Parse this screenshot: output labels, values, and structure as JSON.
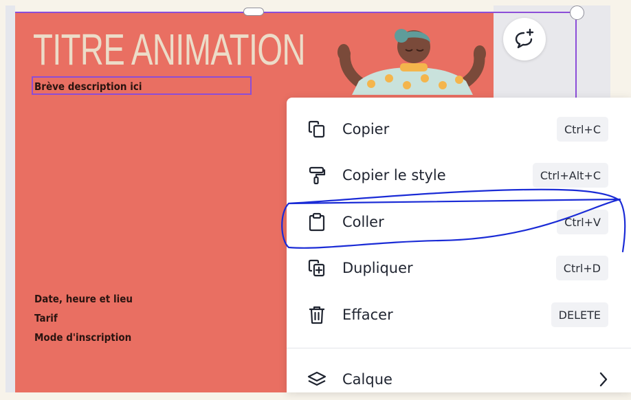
{
  "design": {
    "title": "TITRE ANIMATION",
    "subtitle": "Brève description ici",
    "info_lines": [
      "Date, heure et lieu",
      "Tarif",
      "Mode d'inscription"
    ],
    "background_color": "#e96f62",
    "selection_color": "#8b4dd8"
  },
  "comment_button": {
    "icon": "add-comment-icon"
  },
  "context_menu": {
    "items": [
      {
        "label": "Copier",
        "shortcut": "Ctrl+C",
        "icon": "copy-icon"
      },
      {
        "label": "Copier le style",
        "shortcut": "Ctrl+Alt+C",
        "icon": "paint-roller-icon"
      },
      {
        "label": "Coller",
        "shortcut": "Ctrl+V",
        "icon": "clipboard-icon"
      },
      {
        "label": "Dupliquer",
        "shortcut": "Ctrl+D",
        "icon": "duplicate-icon"
      },
      {
        "label": "Effacer",
        "shortcut": "DELETE",
        "icon": "trash-icon"
      },
      {
        "label": "Calque",
        "shortcut": "",
        "icon": "layers-icon",
        "submenu": true
      }
    ]
  },
  "annotation": {
    "color": "#1a2bd6",
    "circled_item": "Coller"
  }
}
